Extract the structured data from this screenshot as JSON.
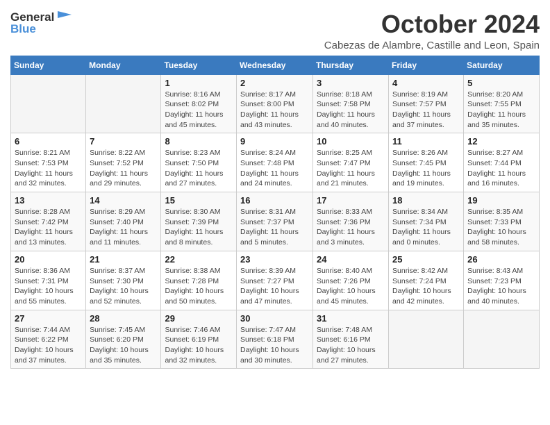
{
  "header": {
    "logo_text_general": "General",
    "logo_text_blue": "Blue",
    "title": "October 2024",
    "subtitle": "Cabezas de Alambre, Castille and Leon, Spain"
  },
  "calendar": {
    "days_of_week": [
      "Sunday",
      "Monday",
      "Tuesday",
      "Wednesday",
      "Thursday",
      "Friday",
      "Saturday"
    ],
    "weeks": [
      [
        {
          "day": "",
          "info": ""
        },
        {
          "day": "",
          "info": ""
        },
        {
          "day": "1",
          "info": "Sunrise: 8:16 AM\nSunset: 8:02 PM\nDaylight: 11 hours and 45 minutes."
        },
        {
          "day": "2",
          "info": "Sunrise: 8:17 AM\nSunset: 8:00 PM\nDaylight: 11 hours and 43 minutes."
        },
        {
          "day": "3",
          "info": "Sunrise: 8:18 AM\nSunset: 7:58 PM\nDaylight: 11 hours and 40 minutes."
        },
        {
          "day": "4",
          "info": "Sunrise: 8:19 AM\nSunset: 7:57 PM\nDaylight: 11 hours and 37 minutes."
        },
        {
          "day": "5",
          "info": "Sunrise: 8:20 AM\nSunset: 7:55 PM\nDaylight: 11 hours and 35 minutes."
        }
      ],
      [
        {
          "day": "6",
          "info": "Sunrise: 8:21 AM\nSunset: 7:53 PM\nDaylight: 11 hours and 32 minutes."
        },
        {
          "day": "7",
          "info": "Sunrise: 8:22 AM\nSunset: 7:52 PM\nDaylight: 11 hours and 29 minutes."
        },
        {
          "day": "8",
          "info": "Sunrise: 8:23 AM\nSunset: 7:50 PM\nDaylight: 11 hours and 27 minutes."
        },
        {
          "day": "9",
          "info": "Sunrise: 8:24 AM\nSunset: 7:48 PM\nDaylight: 11 hours and 24 minutes."
        },
        {
          "day": "10",
          "info": "Sunrise: 8:25 AM\nSunset: 7:47 PM\nDaylight: 11 hours and 21 minutes."
        },
        {
          "day": "11",
          "info": "Sunrise: 8:26 AM\nSunset: 7:45 PM\nDaylight: 11 hours and 19 minutes."
        },
        {
          "day": "12",
          "info": "Sunrise: 8:27 AM\nSunset: 7:44 PM\nDaylight: 11 hours and 16 minutes."
        }
      ],
      [
        {
          "day": "13",
          "info": "Sunrise: 8:28 AM\nSunset: 7:42 PM\nDaylight: 11 hours and 13 minutes."
        },
        {
          "day": "14",
          "info": "Sunrise: 8:29 AM\nSunset: 7:40 PM\nDaylight: 11 hours and 11 minutes."
        },
        {
          "day": "15",
          "info": "Sunrise: 8:30 AM\nSunset: 7:39 PM\nDaylight: 11 hours and 8 minutes."
        },
        {
          "day": "16",
          "info": "Sunrise: 8:31 AM\nSunset: 7:37 PM\nDaylight: 11 hours and 5 minutes."
        },
        {
          "day": "17",
          "info": "Sunrise: 8:33 AM\nSunset: 7:36 PM\nDaylight: 11 hours and 3 minutes."
        },
        {
          "day": "18",
          "info": "Sunrise: 8:34 AM\nSunset: 7:34 PM\nDaylight: 11 hours and 0 minutes."
        },
        {
          "day": "19",
          "info": "Sunrise: 8:35 AM\nSunset: 7:33 PM\nDaylight: 10 hours and 58 minutes."
        }
      ],
      [
        {
          "day": "20",
          "info": "Sunrise: 8:36 AM\nSunset: 7:31 PM\nDaylight: 10 hours and 55 minutes."
        },
        {
          "day": "21",
          "info": "Sunrise: 8:37 AM\nSunset: 7:30 PM\nDaylight: 10 hours and 52 minutes."
        },
        {
          "day": "22",
          "info": "Sunrise: 8:38 AM\nSunset: 7:28 PM\nDaylight: 10 hours and 50 minutes."
        },
        {
          "day": "23",
          "info": "Sunrise: 8:39 AM\nSunset: 7:27 PM\nDaylight: 10 hours and 47 minutes."
        },
        {
          "day": "24",
          "info": "Sunrise: 8:40 AM\nSunset: 7:26 PM\nDaylight: 10 hours and 45 minutes."
        },
        {
          "day": "25",
          "info": "Sunrise: 8:42 AM\nSunset: 7:24 PM\nDaylight: 10 hours and 42 minutes."
        },
        {
          "day": "26",
          "info": "Sunrise: 8:43 AM\nSunset: 7:23 PM\nDaylight: 10 hours and 40 minutes."
        }
      ],
      [
        {
          "day": "27",
          "info": "Sunrise: 7:44 AM\nSunset: 6:22 PM\nDaylight: 10 hours and 37 minutes."
        },
        {
          "day": "28",
          "info": "Sunrise: 7:45 AM\nSunset: 6:20 PM\nDaylight: 10 hours and 35 minutes."
        },
        {
          "day": "29",
          "info": "Sunrise: 7:46 AM\nSunset: 6:19 PM\nDaylight: 10 hours and 32 minutes."
        },
        {
          "day": "30",
          "info": "Sunrise: 7:47 AM\nSunset: 6:18 PM\nDaylight: 10 hours and 30 minutes."
        },
        {
          "day": "31",
          "info": "Sunrise: 7:48 AM\nSunset: 6:16 PM\nDaylight: 10 hours and 27 minutes."
        },
        {
          "day": "",
          "info": ""
        },
        {
          "day": "",
          "info": ""
        }
      ]
    ]
  }
}
